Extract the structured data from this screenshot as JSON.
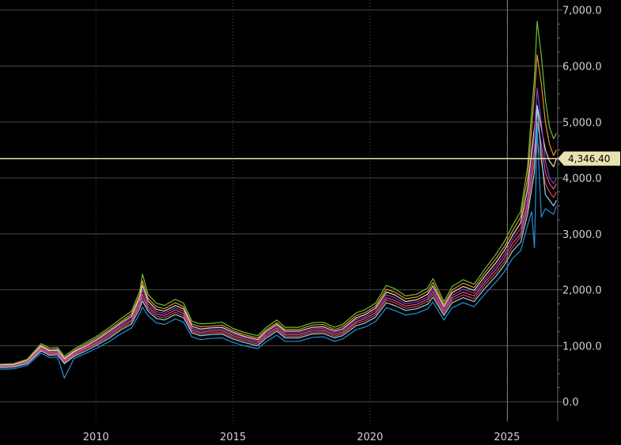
{
  "chart_data": {
    "type": "line",
    "title": "",
    "xlabel": "",
    "ylabel": "",
    "xlim": [
      2006.5,
      2026.85
    ],
    "ylim": [
      -350,
      7180
    ],
    "grid": true,
    "x_ticks": [
      {
        "value": 2010,
        "label": "2010"
      },
      {
        "value": 2015,
        "label": "2015"
      },
      {
        "value": 2020,
        "label": "2020"
      },
      {
        "value": 2025,
        "label": "2025"
      }
    ],
    "y_ticks": [
      {
        "value": 0,
        "label": "0.0"
      },
      {
        "value": 1000,
        "label": "1,000.0"
      },
      {
        "value": 2000,
        "label": "2,000.0"
      },
      {
        "value": 3000,
        "label": "3,000.0"
      },
      {
        "value": 4000,
        "label": "4,000.0"
      },
      {
        "value": 5000,
        "label": "5,000.0"
      },
      {
        "value": 6000,
        "label": "6,000.0"
      },
      {
        "value": 7000,
        "label": "7,000.0"
      }
    ],
    "last_price": {
      "value": 4346.4,
      "label": "4,346.40"
    },
    "x": [
      2006.5,
      2007.0,
      2007.5,
      2008.0,
      2008.3,
      2008.6,
      2008.85,
      2009.2,
      2009.6,
      2010.0,
      2010.5,
      2010.9,
      2011.3,
      2011.6,
      2011.7,
      2011.9,
      2012.2,
      2012.5,
      2012.9,
      2013.2,
      2013.5,
      2013.8,
      2014.2,
      2014.6,
      2015.0,
      2015.4,
      2015.9,
      2016.2,
      2016.6,
      2016.9,
      2017.4,
      2017.9,
      2018.3,
      2018.7,
      2019.0,
      2019.5,
      2019.8,
      2020.2,
      2020.6,
      2020.9,
      2021.3,
      2021.7,
      2022.1,
      2022.3,
      2022.7,
      2023.0,
      2023.4,
      2023.8,
      2024.2,
      2024.6,
      2024.9,
      2025.2,
      2025.5,
      2025.75,
      2025.9,
      2026.0,
      2026.1,
      2026.25,
      2026.4,
      2026.55,
      2026.7,
      2026.8
    ],
    "series": [
      {
        "color": "#6dbf3a",
        "values": [
          670,
          680,
          760,
          1040,
          960,
          970,
          810,
          940,
          1050,
          1160,
          1330,
          1480,
          1620,
          1980,
          2280,
          1920,
          1760,
          1720,
          1830,
          1760,
          1440,
          1390,
          1400,
          1420,
          1310,
          1240,
          1180,
          1320,
          1460,
          1330,
          1330,
          1410,
          1420,
          1330,
          1380,
          1590,
          1640,
          1760,
          2080,
          2020,
          1890,
          1920,
          2030,
          2200,
          1790,
          2060,
          2180,
          2100,
          2380,
          2640,
          2860,
          3150,
          3400,
          4200,
          5200,
          5800,
          6800,
          6200,
          5400,
          4900,
          4700,
          4800
        ]
      },
      {
        "color": "#e8932a",
        "values": [
          660,
          670,
          740,
          1010,
          930,
          940,
          780,
          910,
          1020,
          1130,
          1290,
          1430,
          1570,
          1910,
          2160,
          1850,
          1700,
          1660,
          1770,
          1700,
          1390,
          1340,
          1350,
          1370,
          1270,
          1200,
          1140,
          1280,
          1410,
          1290,
          1290,
          1370,
          1380,
          1290,
          1340,
          1540,
          1590,
          1710,
          2010,
          1960,
          1840,
          1870,
          1970,
          2130,
          1740,
          2000,
          2120,
          2040,
          2310,
          2560,
          2770,
          3050,
          3300,
          4000,
          4900,
          5500,
          6200,
          5700,
          5000,
          4600,
          4400,
          4500
        ]
      },
      {
        "color": "#e9e2b0",
        "values": [
          650,
          660,
          730,
          990,
          910,
          920,
          760,
          890,
          990,
          1100,
          1260,
          1400,
          1530,
          1860,
          2080,
          1800,
          1650,
          1620,
          1720,
          1660,
          1350,
          1300,
          1320,
          1330,
          1240,
          1170,
          1110,
          1250,
          1380,
          1260,
          1260,
          1330,
          1340,
          1260,
          1300,
          1500,
          1550,
          1670,
          1960,
          1910,
          1790,
          1820,
          1920,
          2070,
          1700,
          1950,
          2060,
          1990,
          2250,
          2490,
          2700,
          2970,
          3200,
          3800,
          4500,
          4900,
          5300,
          4900,
          4500,
          4300,
          4200,
          4346
        ]
      },
      {
        "color": "#8a3fd1",
        "values": [
          640,
          650,
          720,
          970,
          890,
          900,
          740,
          870,
          970,
          1080,
          1230,
          1370,
          1500,
          1810,
          2000,
          1750,
          1610,
          1580,
          1680,
          1620,
          1320,
          1270,
          1290,
          1300,
          1210,
          1150,
          1090,
          1220,
          1350,
          1230,
          1230,
          1300,
          1310,
          1230,
          1270,
          1470,
          1510,
          1630,
          1910,
          1860,
          1750,
          1780,
          1870,
          2020,
          1660,
          1900,
          2010,
          1940,
          2190,
          2430,
          2630,
          2900,
          3100,
          3650,
          4300,
          4800,
          5600,
          5000,
          4300,
          4000,
          3900,
          4000
        ]
      },
      {
        "color": "#e0508f",
        "values": [
          630,
          640,
          700,
          950,
          870,
          880,
          720,
          850,
          950,
          1050,
          1200,
          1340,
          1460,
          1760,
          1920,
          1700,
          1570,
          1540,
          1640,
          1580,
          1290,
          1240,
          1260,
          1270,
          1180,
          1120,
          1060,
          1190,
          1320,
          1200,
          1200,
          1270,
          1280,
          1200,
          1240,
          1430,
          1480,
          1590,
          1860,
          1810,
          1710,
          1740,
          1830,
          1970,
          1620,
          1860,
          1960,
          1890,
          2140,
          2370,
          2570,
          2830,
          3000,
          3550,
          4100,
          4500,
          5000,
          4600,
          4100,
          3900,
          3800,
          3900
        ]
      },
      {
        "color": "#d44a3a",
        "values": [
          620,
          630,
          690,
          930,
          850,
          860,
          700,
          830,
          930,
          1030,
          1170,
          1310,
          1430,
          1720,
          1860,
          1660,
          1530,
          1500,
          1600,
          1540,
          1260,
          1210,
          1230,
          1240,
          1150,
          1090,
          1030,
          1160,
          1290,
          1170,
          1170,
          1240,
          1250,
          1170,
          1210,
          1400,
          1440,
          1550,
          1820,
          1770,
          1670,
          1700,
          1790,
          1920,
          1580,
          1820,
          1910,
          1840,
          2090,
          2310,
          2500,
          2760,
          2950,
          3450,
          3950,
          4300,
          4700,
          4300,
          3900,
          3750,
          3650,
          3750
        ]
      },
      {
        "color": "#8fd3f4",
        "values": [
          610,
          620,
          680,
          910,
          830,
          840,
          680,
          810,
          900,
          1000,
          1140,
          1280,
          1390,
          1670,
          1800,
          1620,
          1490,
          1460,
          1560,
          1500,
          1230,
          1180,
          1200,
          1210,
          1120,
          1060,
          1000,
          1130,
          1260,
          1140,
          1140,
          1210,
          1220,
          1140,
          1180,
          1360,
          1400,
          1510,
          1770,
          1720,
          1630,
          1660,
          1740,
          1870,
          1540,
          1770,
          1860,
          1790,
          2030,
          2250,
          2440,
          2690,
          2850,
          3350,
          3800,
          4100,
          5300,
          4400,
          3700,
          3600,
          3500,
          3600
        ]
      },
      {
        "color": "#2a8fd6",
        "values": [
          580,
          590,
          650,
          870,
          790,
          800,
          420,
          770,
          860,
          950,
          1080,
          1210,
          1320,
          1580,
          1690,
          1540,
          1410,
          1380,
          1480,
          1420,
          1160,
          1110,
          1130,
          1140,
          1060,
          1000,
          950,
          1070,
          1190,
          1080,
          1080,
          1150,
          1160,
          1080,
          1120,
          1290,
          1330,
          1430,
          1680,
          1630,
          1550,
          1580,
          1660,
          1780,
          1460,
          1680,
          1770,
          1700,
          1930,
          2140,
          2320,
          2560,
          2700,
          3150,
          3400,
          2750,
          4900,
          3300,
          3450,
          3400,
          3350,
          3500
        ]
      }
    ]
  }
}
